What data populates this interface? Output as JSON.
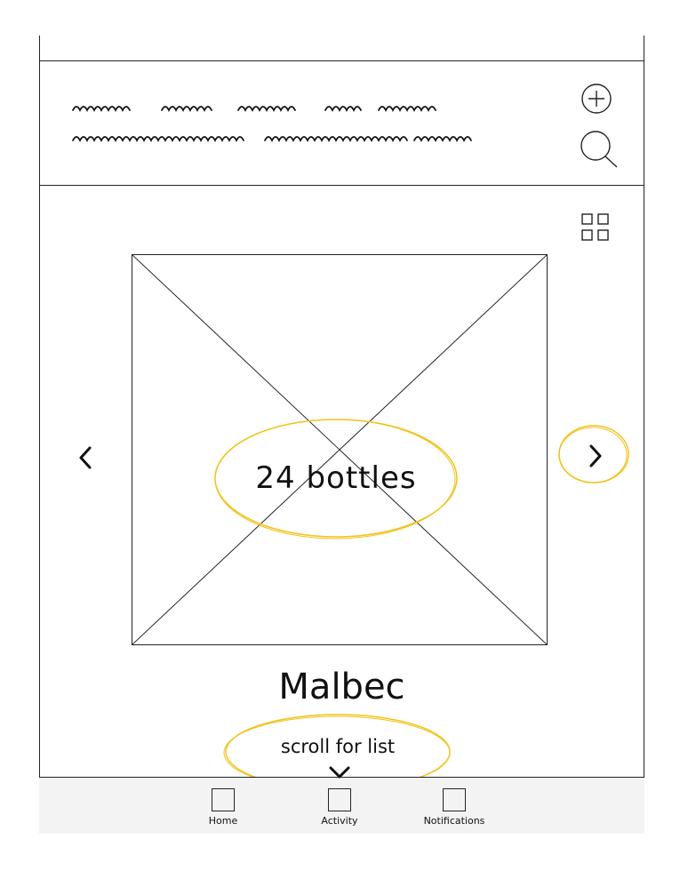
{
  "header": {
    "scribble_lines": [
      "",
      ""
    ]
  },
  "icons": {
    "add": "plus-circle-icon",
    "search": "search-icon",
    "grid": "grid-view-icon",
    "prev": "chevron-left-icon",
    "next": "chevron-right-icon",
    "scroll": "chevron-down-icon"
  },
  "carousel": {
    "bottle_count": "24 bottles",
    "wine_name": "Malbec",
    "scroll_hint": "scroll for list"
  },
  "tabbar": {
    "tabs": [
      {
        "label": "Home"
      },
      {
        "label": "Activity"
      },
      {
        "label": "Notifications"
      }
    ]
  },
  "colors": {
    "highlight": "#f2c318",
    "ink": "#111111",
    "tabbar_bg": "#f3f3f3"
  }
}
